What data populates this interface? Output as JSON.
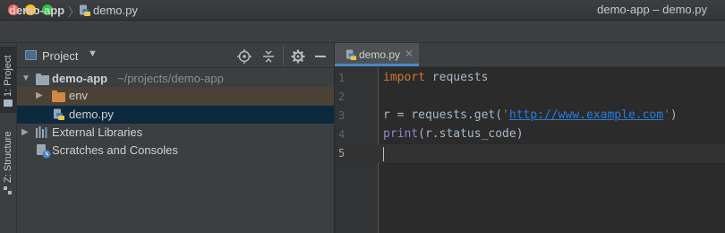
{
  "window": {
    "title": "demo-app – demo.py"
  },
  "navbar": {
    "project": "demo-app",
    "file": "demo.py"
  },
  "stripe": {
    "project_tab": "1: Project",
    "structure_tab": "Z: Structure"
  },
  "panel": {
    "title": "Project",
    "tree": {
      "root_name": "demo-app",
      "root_path": "~/projects/demo-app",
      "env": "env",
      "file": "demo.py",
      "libraries": "External Libraries",
      "scratches": "Scratches and Consoles"
    }
  },
  "editor": {
    "tab": "demo.py",
    "lines": [
      "1",
      "2",
      "3",
      "4",
      "5"
    ],
    "code": {
      "l1_kw": "import",
      "l1_rest": " requests",
      "l3_a": "r = requests.get(",
      "l3_q1": "'",
      "l3_url": "http://www.example.com",
      "l3_q2": "'",
      "l3_b": ")",
      "l4_fn": "print",
      "l4_rest": "(r.status_code)"
    }
  },
  "colors": {
    "keyword": "#cc7832",
    "string": "#6a8759",
    "url": "#287bde",
    "builtin": "#8888c6",
    "selection": "#0d293e",
    "excluded_row": "#4b4235"
  }
}
